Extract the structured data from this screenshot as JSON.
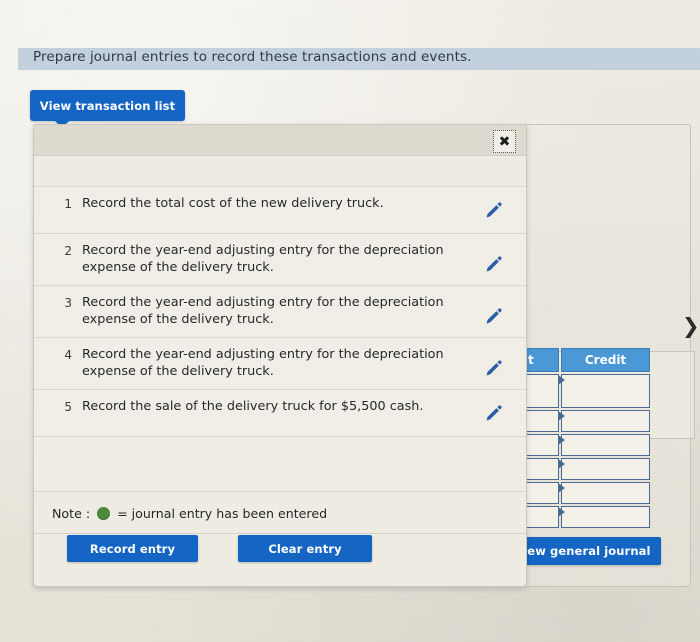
{
  "banner": {
    "instruction": "Prepare journal entries to record these transactions and events."
  },
  "toolbar": {
    "view_transaction_list_label": "View transaction list"
  },
  "modal": {
    "close_icon": "close-x-icon",
    "entries": [
      {
        "num": "1",
        "text": "Record the total cost of the new delivery truck.",
        "icon": "pencil-icon"
      },
      {
        "num": "2",
        "text": "Record the year-end adjusting entry for the depreciation expense of the delivery truck.",
        "icon": "pencil-icon"
      },
      {
        "num": "3",
        "text": "Record the year-end adjusting entry for the depreciation expense of the delivery truck.",
        "icon": "pencil-icon"
      },
      {
        "num": "4",
        "text": "Record the year-end adjusting entry for the depreciation expense of the delivery truck.",
        "icon": "pencil-icon"
      },
      {
        "num": "5",
        "text": "Record the sale of the delivery truck for $5,500 cash.",
        "icon": "pencil-icon"
      }
    ],
    "note": {
      "prefix": "Note :",
      "legend": "= journal entry has been entered",
      "dot_color": "#4d8a3b"
    },
    "footer": {
      "record_entry_label": "Record entry",
      "clear_entry_label": "Clear entry"
    }
  },
  "background_panel": {
    "chevron_icon": "chevron-right-icon",
    "view_general_journal_label": "View general journal",
    "journal_table": {
      "columns": [
        "Debit",
        "Credit"
      ],
      "rows": [
        {
          "debit": "",
          "credit": ""
        },
        {
          "debit": "",
          "credit": ""
        },
        {
          "debit": "",
          "credit": ""
        },
        {
          "debit": "",
          "credit": ""
        },
        {
          "debit": "",
          "credit": ""
        },
        {
          "debit": "",
          "credit": ""
        }
      ]
    }
  },
  "colors": {
    "primary_blue": "#1566c4",
    "table_header_blue": "#4b98d6",
    "banner_blue": "#c3d1de",
    "pencil_blue": "#2a5fa8",
    "note_green": "#4d8a3b",
    "page_background": "#eae7de"
  }
}
